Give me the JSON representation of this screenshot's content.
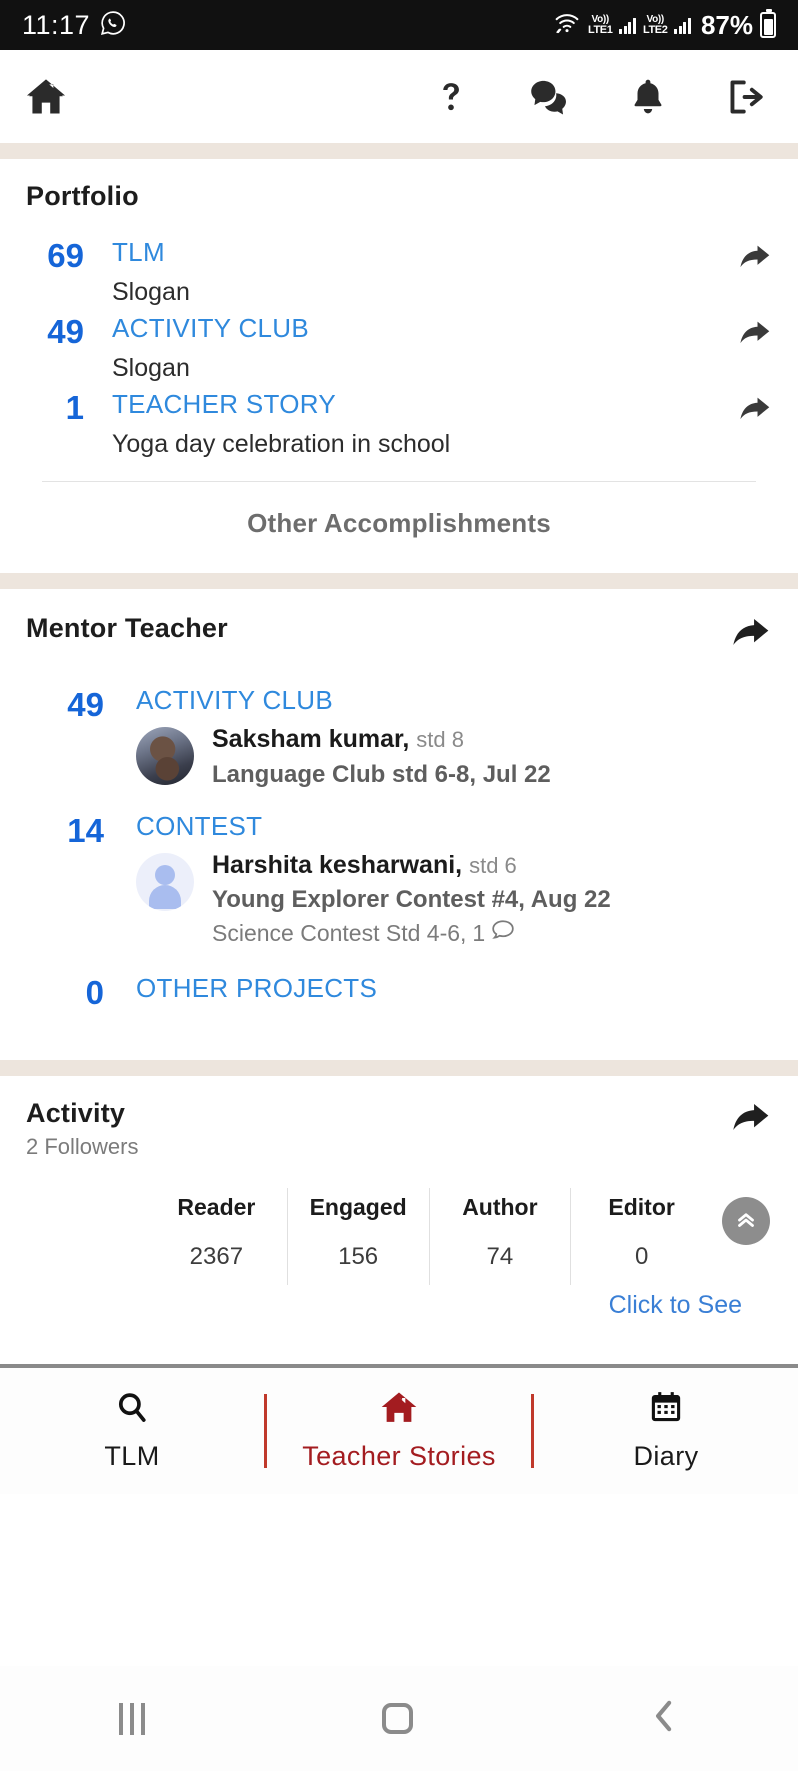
{
  "status_bar": {
    "time": "11:17",
    "whatsapp_icon": "whatsapp-icon",
    "wifi_icon": "wifi-icon",
    "sim1_label_top": "Vo))",
    "sim1_label_bottom": "LTE1",
    "sim2_label_top": "Vo))",
    "sim2_label_bottom": "LTE2",
    "battery_percent": "87%"
  },
  "app_bar": {
    "home_icon": "home-icon",
    "help_icon": "question-mark-icon",
    "chat_icon": "chat-bubble-icon",
    "bell_icon": "bell-icon",
    "logout_icon": "logout-icon"
  },
  "portfolio": {
    "title": "Portfolio",
    "items": [
      {
        "count": "69",
        "label": "TLM",
        "desc": "Slogan",
        "share_icon": "share-arrow-icon"
      },
      {
        "count": "49",
        "label": "ACTIVITY CLUB",
        "desc": "Slogan",
        "share_icon": "share-arrow-icon"
      },
      {
        "count": "1",
        "label": "TEACHER STORY",
        "desc": "Yoga day celebration in school",
        "share_icon": "share-arrow-icon"
      }
    ],
    "other_accomplishments": "Other Accomplishments"
  },
  "mentor_teacher": {
    "title": "Mentor Teacher",
    "share_icon": "share-arrow-icon",
    "items": [
      {
        "count": "49",
        "label": "ACTIVITY CLUB",
        "person": {
          "avatar": "student-photo-avatar",
          "name": "Saksham kumar,",
          "std": "std 8",
          "meta": "Language Club std 6-8, Jul 22",
          "meta2": "",
          "comment_count": ""
        }
      },
      {
        "count": "14",
        "label": "CONTEST",
        "person": {
          "avatar": "default-person-avatar",
          "name": "Harshita kesharwani,",
          "std": "std 6",
          "meta": "Young Explorer Contest #4, Aug 22",
          "meta2": "Science Contest Std 4-6,",
          "comment_count": "1",
          "comment_icon": "comment-bubble-icon"
        }
      },
      {
        "count": "0",
        "label": "OTHER PROJECTS",
        "person": null
      }
    ]
  },
  "activity": {
    "title": "Activity",
    "followers": "2 Followers",
    "share_icon": "share-arrow-icon",
    "scroll_top_icon": "double-chevron-up-icon",
    "click_to_see": "Click to See",
    "stats_headers": [
      "Reader",
      "Engaged",
      "Author",
      "Editor"
    ],
    "stats_values": [
      "2367",
      "156",
      "74",
      "0"
    ]
  },
  "bottom_nav": {
    "items": [
      {
        "label": "TLM",
        "icon": "search-icon",
        "active": false
      },
      {
        "label": "Teacher Stories",
        "icon": "home-icon",
        "active": true
      },
      {
        "label": "Diary",
        "icon": "calendar-icon",
        "active": false
      }
    ]
  },
  "system_nav": {
    "recents_icon": "recents-bars-icon",
    "home_icon": "home-square-icon",
    "back_icon": "back-chevron-icon"
  },
  "colors": {
    "accent_blue": "#2f89dd",
    "count_blue": "#1565d8",
    "active_red": "#a31c20",
    "band_beige": "#ede5dd"
  }
}
